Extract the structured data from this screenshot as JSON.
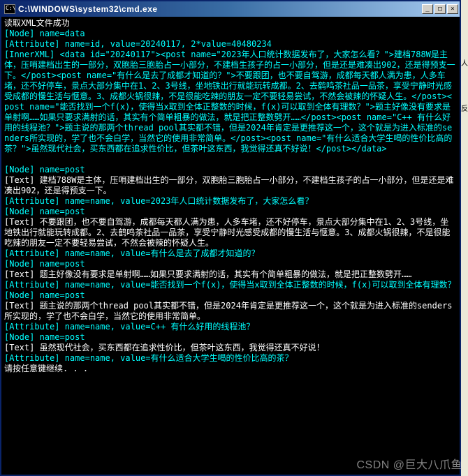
{
  "window": {
    "title": "C:\\WINDOWS\\system32\\cmd.exe",
    "btn_min": "_",
    "btn_max": "□",
    "btn_close": "×"
  },
  "side": {
    "a": "人",
    "b": "反"
  },
  "watermark": "CSDN @巨大八爪鱼",
  "lines": [
    {
      "t": "读取XML文件成功",
      "c": "w"
    },
    {
      "t": "[Node] name=data",
      "c": "c"
    },
    {
      "t": "[Attribute] name=id, value=20240117, 2*value=40480234",
      "c": "c"
    },
    {
      "t": "[InnerXML] <data id=\"20240117\"><post name=\"2023年人口统计数据发布了，大家怎么看？\">建档788W是主体，压哨建档出生的一部分，双胞胎三胞胎占一小部分，不建档生孩子的占一小部分，但是还是难凑出902，还是得预支一下。</post><post name=\"有什么是去了成都才知道的？\">不要跟团，也不要自驾游，成都每天都人满为患，人多车堵，还不好停车，景点大部分集中在1、2、3号线，坐地铁出行就能玩转成都。2、去鹤鸣茶社品一品茶，享受宁静时光感受成都的慢生活与惬意。3、成都火锅很辣，不是很能吃辣的朋友一定不要轻易尝试，不然会被辣的怀疑人生。</post><post name=\"能否找到一个f(x)，使得当x取到全体正整数的时候，f(x)可以取到全体有理数？\">题主好像没有要求是单射啊……如果只要求满射的话，其实有个简单粗暴的做法，就是把正整数劈开……</post><post name=\"C++ 有什么好用的线程池？\">题主说的那两个thread pool其实都不错，但是2024年肯定是更推荐这一个，这个就是为进入标准的senders所实现的，学了也不会白学，当然它的使用非常简单。</post><post name=\"有什么适合大学生喝的性价比高的茶？\">虽然现代社会，买东西都在追求性价比，但茶叶这东西，我觉得还真不好说！</post></data>",
      "c": "c"
    },
    {
      "t": "",
      "c": "w"
    },
    {
      "t": "[Node] name=post",
      "c": "c"
    },
    {
      "t": "[Text] 建档788W是主体，压哨建档出生的一部分，双胞胎三胞胎占一小部分，不建档生孩子的占一小部分，但是还是难凑出902，还是得预支一下。",
      "c": "w"
    },
    {
      "t": "[Attribute] name=name, value=2023年人口统计数据发布了，大家怎么看？",
      "c": "c"
    },
    {
      "t": "[Node] name=post",
      "c": "c"
    },
    {
      "t": "[Text] 不要跟团，也不要自驾游，成都每天都人满为患，人多车堵，还不好停车，景点大部分集中在1、2、3号线，坐地铁出行就能玩转成都。2、去鹤鸣茶社品一品茶，享受宁静时光感受成都的慢生活与惬意。3、成都火锅很辣，不是很能吃辣的朋友一定不要轻易尝试，不然会被辣的怀疑人生。",
      "c": "w"
    },
    {
      "t": "[Attribute] name=name, value=有什么是去了成都才知道的？",
      "c": "c"
    },
    {
      "t": "[Node] name=post",
      "c": "c"
    },
    {
      "t": "[Text] 题主好像没有要求是单射啊……如果只要求满射的话，其实有个简单粗暴的做法，就是把正整数劈开……",
      "c": "w"
    },
    {
      "t": "[Attribute] name=name, value=能否找到一个f(x)，使得当x取到全体正整数的时候，f(x)可以取到全体有理数？",
      "c": "c"
    },
    {
      "t": "[Node] name=post",
      "c": "c"
    },
    {
      "t": "[Text] 题主说的那两个thread pool其实都不错，但是2024年肯定是更推荐这一个，这个就是为进入标准的senders所实现的，学了也不会白学，当然它的使用非常简单。",
      "c": "w"
    },
    {
      "t": "[Attribute] name=name, value=C++ 有什么好用的线程池？",
      "c": "c"
    },
    {
      "t": "[Node] name=post",
      "c": "c"
    },
    {
      "t": "[Text] 虽然现代社会，买东西都在追求性价比，但茶叶这东西，我觉得还真不好说！",
      "c": "w"
    },
    {
      "t": "[Attribute] name=name, value=有什么适合大学生喝的性价比高的茶？",
      "c": "c"
    },
    {
      "t": "请按任意键继续. . .",
      "c": "w"
    }
  ]
}
